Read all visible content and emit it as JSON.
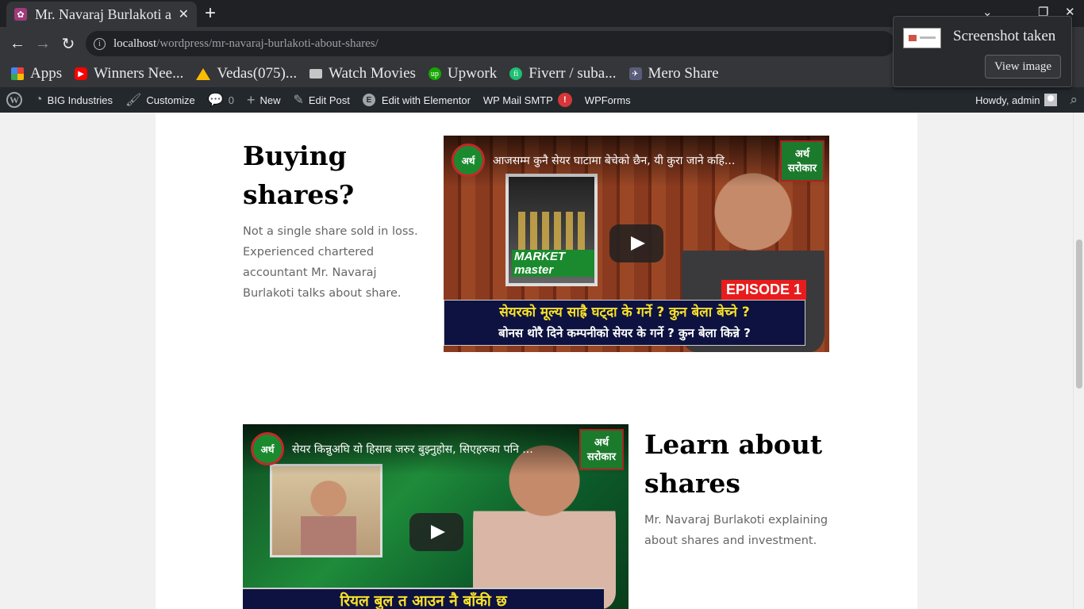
{
  "browser": {
    "tab_title": "Mr. Navaraj Burlakoti a",
    "favicon": "flower-favicon",
    "new_tab": "+",
    "close": "✕",
    "url_host": "localhost",
    "url_path": "/wordpress/mr-navaraj-burlakoti-about-shares/"
  },
  "bookmarks": [
    {
      "label": "Apps",
      "icon": "apps-grid-icon"
    },
    {
      "label": "Winners Nee...",
      "icon": "youtube-icon"
    },
    {
      "label": "Vedas(075)...",
      "icon": "google-drive-icon"
    },
    {
      "label": "Watch Movies",
      "icon": "folder-icon"
    },
    {
      "label": "Upwork",
      "icon": "upwork-icon"
    },
    {
      "label": "Fiverr / suba...",
      "icon": "fiverr-icon"
    },
    {
      "label": "Mero Share",
      "icon": "mero-share-icon"
    }
  ],
  "toast": {
    "title": "Screenshot taken",
    "button": "View image"
  },
  "admin_bar": {
    "site_name": "BIG Industries",
    "customize": "Customize",
    "comments_count": "0",
    "new": "New",
    "edit_post": "Edit Post",
    "elementor": "Edit with Elementor",
    "smtp": "WP Mail SMTP",
    "smtp_badge": "!",
    "wpforms": "WPForms",
    "howdy": "Howdy, admin"
  },
  "sections": [
    {
      "heading_line1": "Buying",
      "heading_line2": "shares?",
      "description": "Not a single share sold in loss. Experienced chartered accountant Mr. Navaraj Burlakoti talks about share.",
      "video": {
        "channel_logo": "अर्थ",
        "title": "आजसम्म कुनै सेयर घाटामा बेचेको छैन, यी कुरा जाने कहि...",
        "brand": "अर्थ सरोकार",
        "poster_label": "MARKET master",
        "episode": "EPISODE 1",
        "caption_line1": "सेयरको मूल्य साह्रै घट्दा के गर्ने ? कुन बेला बेच्ने ?",
        "caption_line2": "बोनस थोरै दिने कम्पनीको सेयर के गर्ने ? कुन बेला किन्ने ?"
      }
    },
    {
      "heading_line1": "Learn about",
      "heading_line2": "shares",
      "description": "Mr. Navaraj Burlakoti explaining about shares and investment.",
      "video": {
        "channel_logo": "अर्थ",
        "title": "सेयर किन्नुअघि यो हिसाब जरुर बुझ्नुहोस, सिएहरुका पनि ...",
        "brand": "अर्थ सरोकार",
        "caption_line1": "रियल बुल त आउन नै बाँकी छ"
      }
    }
  ]
}
